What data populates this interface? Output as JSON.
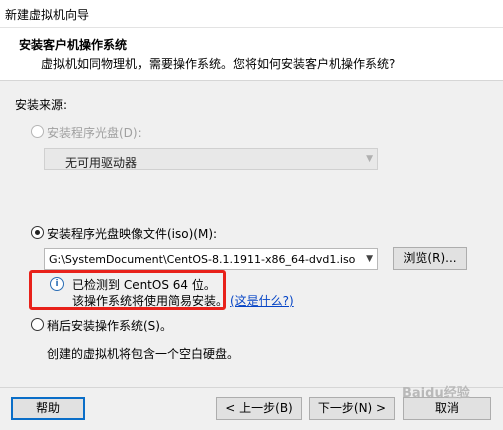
{
  "window": {
    "title": "新建虚拟机向导"
  },
  "header": {
    "title": "安装客户机操作系统",
    "subtitle": "虚拟机如同物理机，需要操作系统。您将如何安装客户机操作系统?"
  },
  "source": {
    "label": "安装来源:",
    "optical_drive": {
      "label": "安装程序光盘(D):",
      "selected": false,
      "enabled": false,
      "dropdown_value": "无可用驱动器"
    },
    "iso_file": {
      "label": "安装程序光盘映像文件(iso)(M):",
      "selected": true,
      "path": "G:\\SystemDocument\\CentOS-8.1.1911-x86_64-dvd1.iso",
      "browse_label": "浏览(R)..."
    },
    "detection": {
      "line1": "已检测到 CentOS 64 位。",
      "line2": "该操作系统将使用简易安装。",
      "link": "(这是什么?)"
    },
    "later": {
      "label": "稍后安装操作系统(S)。",
      "selected": false,
      "desc": "创建的虚拟机将包含一个空白硬盘。"
    }
  },
  "footer": {
    "help": "帮助",
    "back": "< 上一步(B)",
    "next": "下一步(N) >",
    "cancel": "取消"
  },
  "watermark": "Baidu经验",
  "colors": {
    "highlight": "#e8211a",
    "link": "#0645c6",
    "default_button_border": "#0a6ec8"
  }
}
